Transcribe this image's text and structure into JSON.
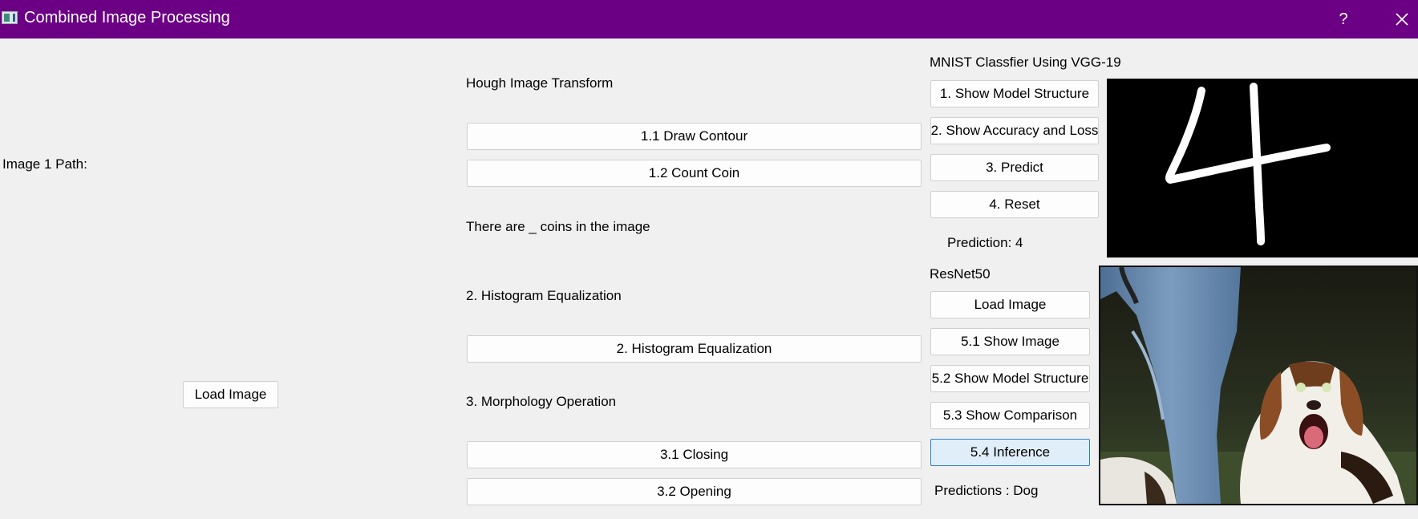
{
  "window": {
    "title": "Combined Image Processing",
    "help_glyph": "?"
  },
  "left": {
    "path_label": "Image 1 Path:",
    "load_button": "Load Image"
  },
  "middle": {
    "hough_title": "Hough Image Transform",
    "draw_contour": "1.1 Draw Contour",
    "count_coin": "1.2 Count Coin",
    "coin_result": "There are _ coins in the image",
    "hist_title": "2. Histogram Equalization",
    "hist_button": "2. Histogram Equalization",
    "morph_title": "3. Morphology Operation",
    "closing": "3.1 Closing",
    "opening": "3.2 Opening"
  },
  "mnist": {
    "title": "MNIST Classfier Using VGG-19",
    "buttons": [
      "1. Show Model Structure",
      "2. Show Accuracy and Loss",
      "3. Predict",
      "4. Reset"
    ],
    "prediction": "Prediction: 4",
    "canvas_digit": "4"
  },
  "resnet": {
    "title": "ResNet50",
    "buttons": [
      "Load Image",
      "5.1 Show Image",
      "5.2 Show Model Structure",
      "5.3 Show Comparison",
      "5.4 Inference"
    ],
    "focused_button": "5.4 Inference",
    "prediction": "Predictions : Dog",
    "image_subject": "beagle-dog-photo"
  }
}
